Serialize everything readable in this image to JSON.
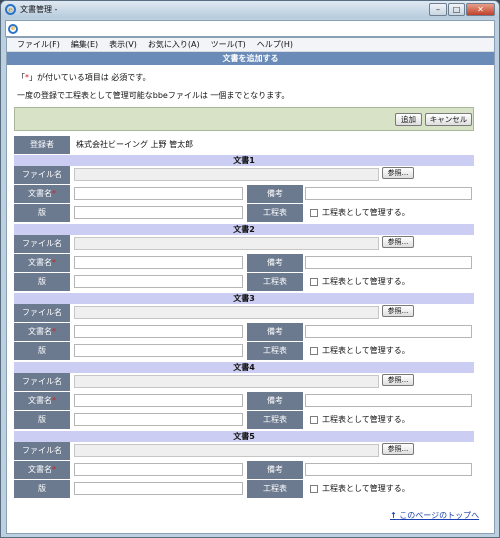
{
  "window": {
    "title": "文書管理 -"
  },
  "menu": [
    "ファイル(F)",
    "編集(E)",
    "表示(V)",
    "お気に入り(A)",
    "ツール(T)",
    "ヘルプ(H)"
  ],
  "banner": "文書を追加する",
  "notes": {
    "required_prefix": "「",
    "required_mark": "*",
    "required_suffix": "」が付いている項目は 必須です。",
    "limit": "一度の登録で工程表として管理可能なbbeファイルは 一個までとなります。"
  },
  "buttons": {
    "add": "追加",
    "cancel": "キャンセル"
  },
  "registrant": {
    "label": "登録者",
    "value": "株式会社ビーイング 上野 管太郎"
  },
  "labels": {
    "file": "ファイル名",
    "name": "文書名",
    "note": "備考",
    "version": "版",
    "schedule": "工程表",
    "browse": "参照...",
    "manage": "工程表として管理する。",
    "required": "*"
  },
  "documents": [
    {
      "header": "文書1"
    },
    {
      "header": "文書2"
    },
    {
      "header": "文書3"
    },
    {
      "header": "文書4"
    },
    {
      "header": "文書5"
    }
  ],
  "footer": {
    "top_arrow": "↑",
    "top_link": "このページのトップへ"
  },
  "colors": {
    "label_bg": "#6b7a8f",
    "banner_bg": "#6a8bb8",
    "doc_header_bg": "#cccdf2",
    "toolbar_bg": "#d8e2c6",
    "required": "#d62020"
  }
}
